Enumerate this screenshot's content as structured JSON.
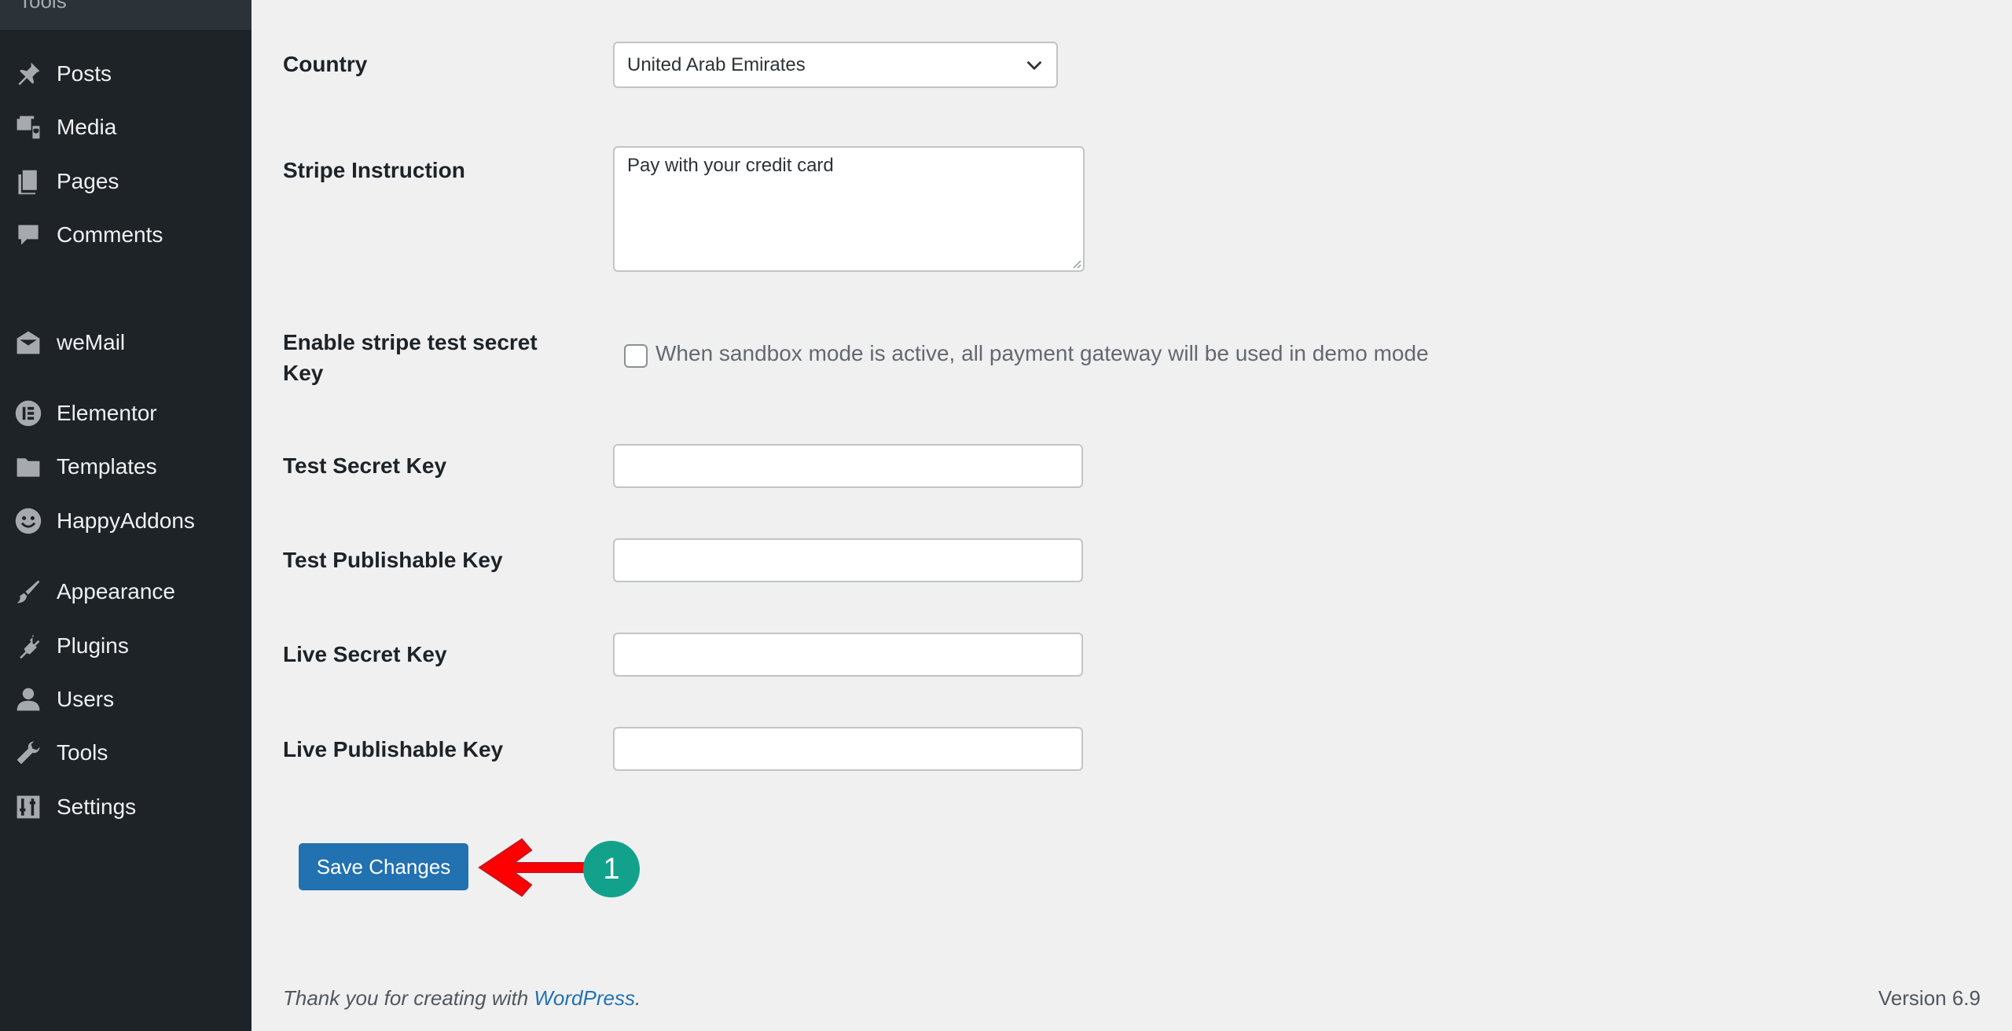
{
  "sidebar": {
    "top_cut_label": "Tools",
    "items": [
      {
        "label": "Posts",
        "icon": "pushpin-icon"
      },
      {
        "label": "Media",
        "icon": "media-icon"
      },
      {
        "label": "Pages",
        "icon": "pages-icon"
      },
      {
        "label": "Comments",
        "icon": "comment-icon"
      },
      {
        "label": "weMail",
        "icon": "envelope-icon"
      },
      {
        "label": "Elementor",
        "icon": "elementor-icon"
      },
      {
        "label": "Templates",
        "icon": "folder-icon"
      },
      {
        "label": "HappyAddons",
        "icon": "happy-face-icon"
      },
      {
        "label": "Appearance",
        "icon": "paintbrush-icon"
      },
      {
        "label": "Plugins",
        "icon": "plug-icon"
      },
      {
        "label": "Users",
        "icon": "user-icon"
      },
      {
        "label": "Tools",
        "icon": "wrench-icon"
      },
      {
        "label": "Settings",
        "icon": "sliders-icon"
      }
    ]
  },
  "form": {
    "country_label": "Country",
    "country_value": "United Arab Emirates",
    "instruction_label": "Stripe Instruction",
    "instruction_value": "Pay with your credit card",
    "sandbox_label": "Enable stripe test secret Key",
    "sandbox_checked": false,
    "sandbox_description": "When sandbox mode is active, all payment gateway will be used in demo mode",
    "test_secret_label": "Test Secret Key",
    "test_secret_value": "",
    "test_publishable_label": "Test Publishable Key",
    "test_publishable_value": "",
    "live_secret_label": "Live Secret Key",
    "live_secret_value": "",
    "live_publishable_label": "Live Publishable Key",
    "live_publishable_value": "",
    "save_label": "Save Changes"
  },
  "callout": {
    "number": "1",
    "color": "#12a28b",
    "arrow_color": "#ff0000"
  },
  "footer": {
    "thanks_prefix": "Thank you for creating with ",
    "thanks_link": "WordPress",
    "thanks_suffix": ".",
    "version": "Version 6.9"
  },
  "colors": {
    "sidebar_bg": "#1d2327",
    "content_bg": "#f0f0f1",
    "primary": "#2271b1"
  }
}
